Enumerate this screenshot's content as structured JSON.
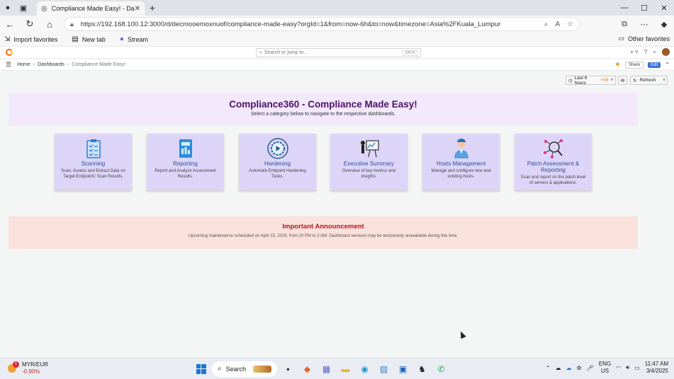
{
  "browser": {
    "tab_title": "Compliance Made Easy! - Dashb",
    "url": "https://192.168.100.12:3000/d/decmooemoxnuof/compliance-made-easy?orgId=1&from=now-6h&to=now&timezone=Asia%2FKuala_Lumpur",
    "favorites": [
      "Import favorites",
      "New tab",
      "Stream"
    ],
    "other_favorites": "Other favorites"
  },
  "grafana": {
    "search_placeholder": "Search or jump to...",
    "search_shortcut": "ctrl+k",
    "breadcrumbs": [
      "Home",
      "Dashboards",
      "Compliance Made Easy!"
    ],
    "share_label": "Share",
    "edit_label": "Edit",
    "time_range": "Last 6 hours",
    "time_offset": "+08",
    "refresh_label": "Refresh"
  },
  "hero": {
    "title": "Compliance360 - Compliance Made Easy!",
    "subtitle": "Select a category below to navigate to the respective dashboards."
  },
  "cards": [
    {
      "title": "Scanning",
      "desc": "Scan, Assess and Extract Data on Target Endpoints' Scan Results.",
      "icon": "clipboard-checklist-icon"
    },
    {
      "title": "Reporting",
      "desc": "Report and Analyze Assessment Results.",
      "icon": "report-document-icon"
    },
    {
      "title": "Hardening",
      "desc": "Automate Endpoint Hardening Tasks.",
      "icon": "gear-play-icon"
    },
    {
      "title": "Executive Summary",
      "desc": "Overview of key metrics and insights.",
      "icon": "presentation-board-icon"
    },
    {
      "title": "Hosts Management",
      "desc": "Manage and configure new and existing hosts.",
      "icon": "person-admin-icon"
    },
    {
      "title": "Patch Assessment & Reporting",
      "desc": "Scan and report on the patch level of servers & applications.",
      "icon": "network-search-icon"
    }
  ],
  "announcement": {
    "title": "Important Announcement",
    "text": "Upcoming maintenance scheduled on April 15, 2025, from 10 PM to 2 AM. Dashboard services may be temporarily unavailable during this time."
  },
  "taskbar": {
    "weather_title": "MYR/EUR",
    "weather_change": "-0.90%",
    "weather_badge": "1",
    "search_label": "Search",
    "lang_line1": "ENG",
    "lang_line2": "US",
    "time": "11:47 AM",
    "date": "3/4/2025"
  },
  "colors": {
    "hero_bg": "#f3e8fc",
    "hero_title": "#4a1466",
    "card_bg": "#ddd5f7",
    "card_title": "#2c4ea0",
    "announcement_bg": "#fbe1dc",
    "announcement_title": "#b11a1a"
  }
}
